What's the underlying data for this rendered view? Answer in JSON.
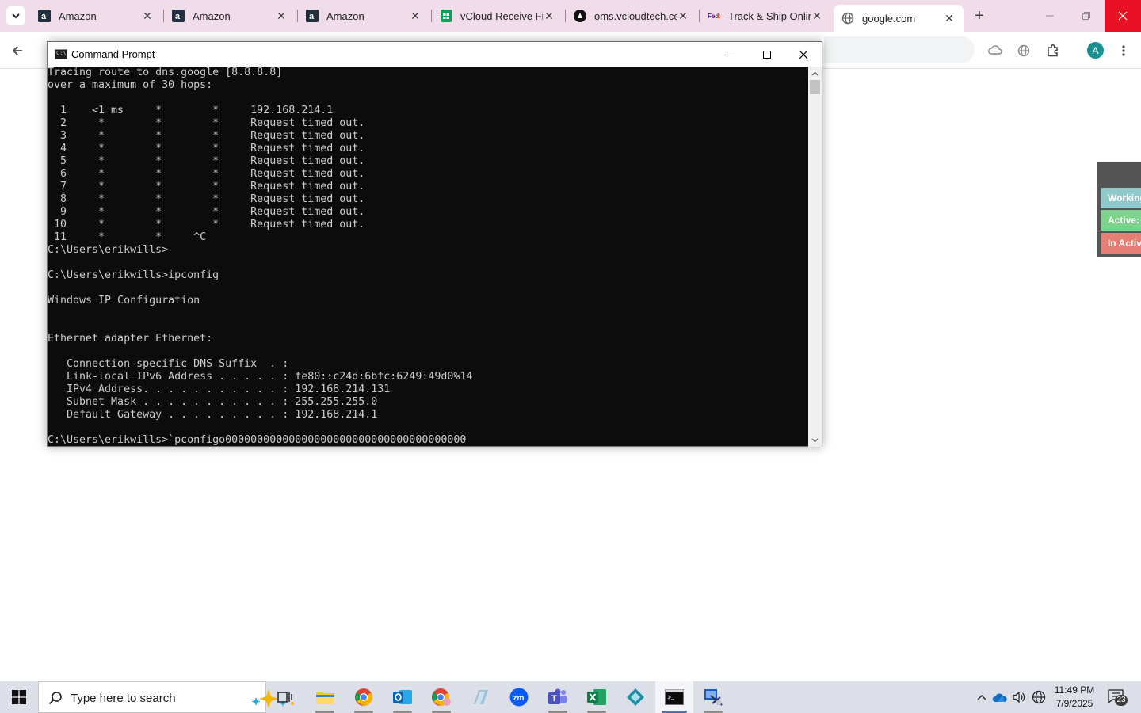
{
  "browser": {
    "tabs": [
      {
        "title": "Amazon",
        "icon": "amazon-icon"
      },
      {
        "title": "Amazon",
        "icon": "amazon-icon"
      },
      {
        "title": "Amazon",
        "icon": "amazon-icon"
      },
      {
        "title": "vCloud Receive File",
        "icon": "sheets-icon"
      },
      {
        "title": "oms.vcloudtech.com",
        "icon": "vcloud-icon"
      },
      {
        "title": "Track & Ship Online",
        "icon": "fedex-icon"
      },
      {
        "title": "google.com",
        "icon": "globe-icon",
        "active": true
      }
    ],
    "close_glyph": "✕",
    "new_tab_glyph": "+",
    "profile_initial": "A"
  },
  "side_panel": {
    "buttons": [
      {
        "label": "Working",
        "color": "#8fc9cc"
      },
      {
        "label": "Active:",
        "color": "#7cd38a"
      },
      {
        "label": "In Active",
        "color": "#e57f73"
      }
    ]
  },
  "cmd": {
    "title": "Command Prompt",
    "icon_glyph": "C:\\",
    "lines": [
      "Tracing route to dns.google [8.8.8.8]",
      "over a maximum of 30 hops:",
      "",
      "  1    <1 ms     *        *     192.168.214.1",
      "  2     *        *        *     Request timed out.",
      "  3     *        *        *     Request timed out.",
      "  4     *        *        *     Request timed out.",
      "  5     *        *        *     Request timed out.",
      "  6     *        *        *     Request timed out.",
      "  7     *        *        *     Request timed out.",
      "  8     *        *        *     Request timed out.",
      "  9     *        *        *     Request timed out.",
      " 10     *        *        *     Request timed out.",
      " 11     *        *     ^C",
      "C:\\Users\\erikwills>",
      "",
      "C:\\Users\\erikwills>ipconfig",
      "",
      "Windows IP Configuration",
      "",
      "",
      "Ethernet adapter Ethernet:",
      "",
      "   Connection-specific DNS Suffix  . :",
      "   Link-local IPv6 Address . . . . . : fe80::c24d:6bfc:6249:49d0%14",
      "   IPv4 Address. . . . . . . . . . . : 192.168.214.131",
      "   Subnet Mask . . . . . . . . . . . : 255.255.255.0",
      "   Default Gateway . . . . . . . . . : 192.168.214.1",
      "",
      "C:\\Users\\erikwills>`pconfigo00000000000000000000000000000000000000"
    ]
  },
  "taskbar": {
    "search_placeholder": "Type here to search",
    "time": "11:49 PM",
    "date": "7/9/2025",
    "notification_count": "23"
  }
}
